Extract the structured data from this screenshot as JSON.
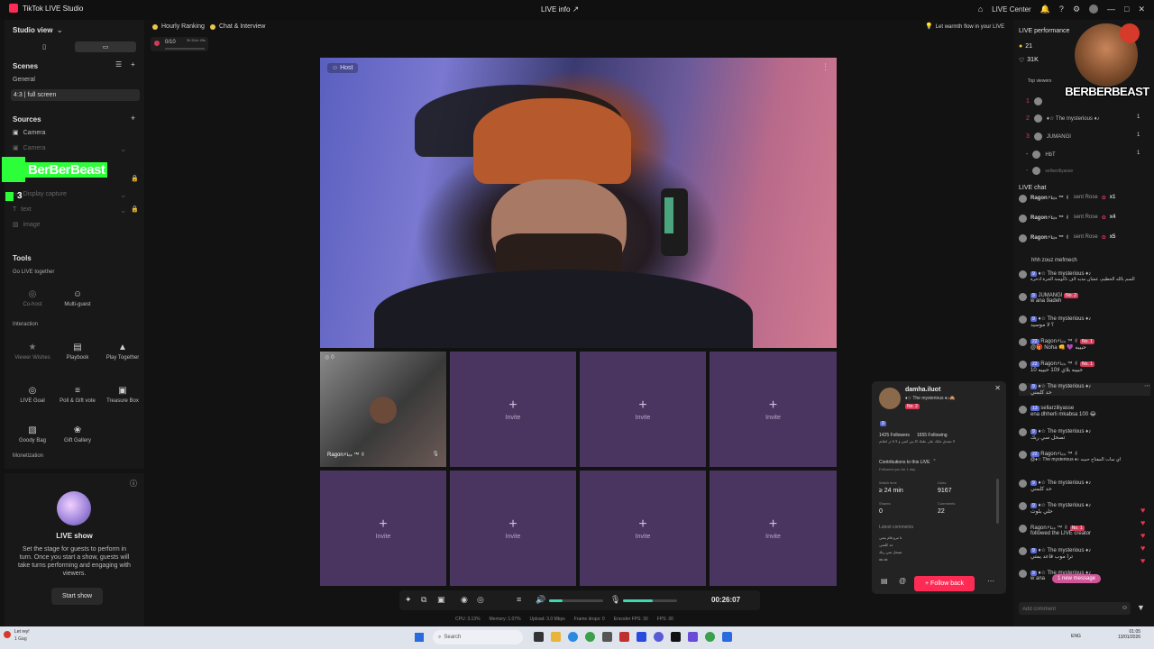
{
  "titlebar": {
    "app_title": "TikTok LIVE Studio",
    "center_title": "LIVE info",
    "live_center": "LIVE Center"
  },
  "left_panel": {
    "view_selector": "Studio view",
    "scenes_title": "Scenes",
    "scene_group": "General",
    "scene_item": "4:3 | full screen",
    "sources_title": "Sources",
    "sources": [
      "Camera",
      "Camera",
      "Display capture",
      "text",
      "image"
    ],
    "overlay_brand": "BerBerBeast",
    "overlay_count": "3",
    "tools_title": "Tools",
    "go_live_together": "Go LIVE together",
    "tools_row1": [
      "Co-host",
      "Multi-guest"
    ],
    "interaction_title": "Interaction",
    "tools_row2": [
      "Viewer Wishes",
      "Playbook",
      "Play Together"
    ],
    "tools_row3": [
      "LIVE Goal",
      "Poll & Gift vote",
      "Treasure Box"
    ],
    "tools_row4": [
      "Goody Bag",
      "Gift Gallery"
    ],
    "monetization_title": "Monetization"
  },
  "live_show": {
    "title": "LIVE show",
    "description": "Set the stage for guests to perform in turn. Once you start a show, guests will take turns performing and engaging with viewers.",
    "button": "Start show"
  },
  "top_chips": {
    "hourly_ranking": "Hourly Ranking",
    "chat_interview": "Chat & Interview",
    "goal_count": "0/10",
    "goal_time": "3h 51m 49s"
  },
  "stage": {
    "host_label": "Host",
    "guest_count": "0",
    "guest_name": "Ragon⚡ʟᵢ₄ ™ ✌",
    "invite_label": "Invite"
  },
  "warmth_banner": "Let warmth flow in your LIVE",
  "controls": {
    "timer": "00:26:07"
  },
  "status_bar": {
    "cpu": "CPU: 3.13%",
    "memory": "Memory: 1.07%",
    "upload": "Upload: 3.0 Mbps",
    "frame_drops": "Frame drops: 0",
    "encoder_fps": "Encoder FPS: 30",
    "fps": "FPS: 30"
  },
  "profile_card": {
    "username": "damha.iluot",
    "subtitle": "♦☆ The mysterious ♦♪🙈",
    "rank_badge": "No. 2",
    "level_badge": "9",
    "followers": "1425 Followers",
    "following": "1655 Following",
    "bio": "لا تصدق عايك على عليك كا بين اثنين و لا 5 ثر اتقاتم",
    "contrib_title": "Contributions to this LIVE",
    "followed_since": "Followed you for 1 day",
    "watch_time_label": "Watch time",
    "watch_time": "≥ 24 min",
    "likes_label": "Likes",
    "likes": "9167",
    "shares_label": "Shares",
    "shares": "0",
    "comments_label": "Comments",
    "comments": "22",
    "latest_comments_label": "Latest comments",
    "latest_comments": [
      "تا مرو قام يمتي",
      "حد كلمني",
      "تصحل سي ربك",
      "ok.ok"
    ],
    "follow_back": "Follow back"
  },
  "right_panel": {
    "performance_title": "LIVE performance",
    "viewers": "21",
    "likes_total": "31K",
    "top_viewers_label": "Top viewers",
    "top_viewers": [
      {
        "rank": "1",
        "name": ""
      },
      {
        "rank": "2",
        "name": "♦☆ The mysterious ♦♪"
      },
      {
        "rank": "3",
        "name": "JUMANGI"
      },
      {
        "rank": "-",
        "name": "HbT"
      },
      {
        "rank": "-",
        "name": "sellarziliyasse"
      }
    ],
    "top_viewer_scores": [
      "1",
      "1",
      "1"
    ],
    "streamer_logo_text": "BERBERBEAST",
    "chat_title": "LIVE chat",
    "gift_rows": [
      {
        "user": "Ragon⚡ʟᵢ₄ ™ ✌",
        "text": "sent Rose",
        "count": "x1"
      },
      {
        "user": "Ragon⚡ʟᵢ₄ ™ ✌",
        "text": "sent Rose",
        "count": "x4"
      },
      {
        "user": "Ragon⚡ʟᵢ₄ ™ ✌",
        "text": "sent Rose",
        "count": "x5"
      }
    ],
    "messages": [
      {
        "user": "",
        "text": "hhh zouz mefmech"
      },
      {
        "user": "♦☆ The mysterious ♦♪",
        "text": "السم بالله الحظيم، عشان مديه لاف ناكوسة الحرة ادخره"
      },
      {
        "user": "JUMANGI",
        "text": "w ana 9adeh"
      },
      {
        "user": "♦☆ The mysterious ♦♪",
        "text": "؟ لا موسيد"
      },
      {
        "user": "Ragon⚡ʟᵢ₄ ™ ✌",
        "text": "@🎁 Noha 👊 💜 حبيبه"
      },
      {
        "user": "Ragon⚡ʟᵢ₄ ™ ✌",
        "text": "10 حبيبه بلاي لا10 حبيبه"
      },
      {
        "user": "♦☆ The mysterious ♦♪",
        "text": "حد كلمني"
      },
      {
        "user": "sellarziliyasse",
        "text": "ena dhherli mkabsa 100 😂"
      },
      {
        "user": "♦☆ The mysterious ♦♪",
        "text": "تصحل سي ربك"
      },
      {
        "user": "Ragon⚡ʟᵢ₄ ™ ✌",
        "text": "@♦☆ The mysterious ♦♪ اي سات المفتاح حبيبه"
      },
      {
        "user": "♦☆ The mysterious ♦♪",
        "text": "حد كلمني"
      },
      {
        "user": "♦☆ The mysterious ♦♪",
        "text": "حلي بلوت"
      },
      {
        "user": "Ragon⚡ʟᵢ₄ ™ ✌",
        "text": "followed the LIVE creator"
      },
      {
        "user": "♦☆ The mysterious ♦♪",
        "text": "ترا موب قاعد يمتي"
      },
      {
        "user": "♦☆ The mysterious ♦♪",
        "text": "w ana"
      }
    ],
    "new_message": "1 new message",
    "add_comment_placeholder": "Add comment"
  },
  "taskbar": {
    "weather_temp": "Let rey!",
    "weather_desc": "1 Gag",
    "search_placeholder": "Search",
    "lang": "ENG",
    "time": "01:05",
    "date": "13/01/2026"
  },
  "colors": {
    "brand_red": "#fe2c55",
    "overlay_green": "#2cff3a",
    "invite_purple": "#4a3560"
  }
}
